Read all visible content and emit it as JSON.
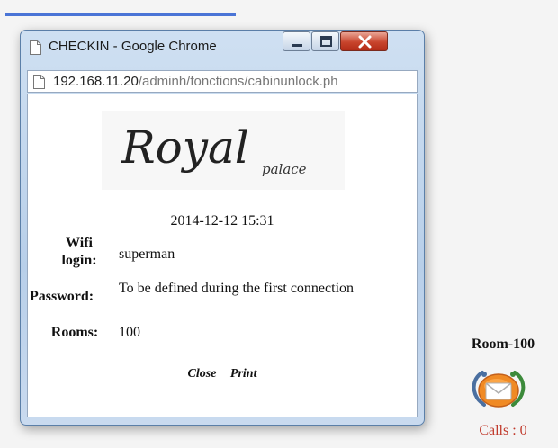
{
  "window": {
    "title": "CHECKIN - Google Chrome"
  },
  "address": {
    "host": "192.168.11.20",
    "path": "/adminh/fonctions/cabinunlock.ph"
  },
  "logo": {
    "text_main": "Royal",
    "text_sub": "palace"
  },
  "checkin": {
    "datetime": "2014-12-12 15:31",
    "wifi_label_line1": "Wifi",
    "wifi_label_line2": "login:",
    "wifi_value": "superman",
    "password_label": "Password:",
    "password_value": "To be defined during the first connection",
    "rooms_label": "Rooms:",
    "rooms_value": "100"
  },
  "actions": {
    "close_label": "Close",
    "print_label": "Print"
  },
  "room_panel": {
    "room_label": "Room-100",
    "calls_label": "Calls : 0",
    "icon": "mail-envelope-icon"
  },
  "colors": {
    "progress": "#4a74d6",
    "calls_text": "#c0392b",
    "close_button": "#c8442c"
  }
}
